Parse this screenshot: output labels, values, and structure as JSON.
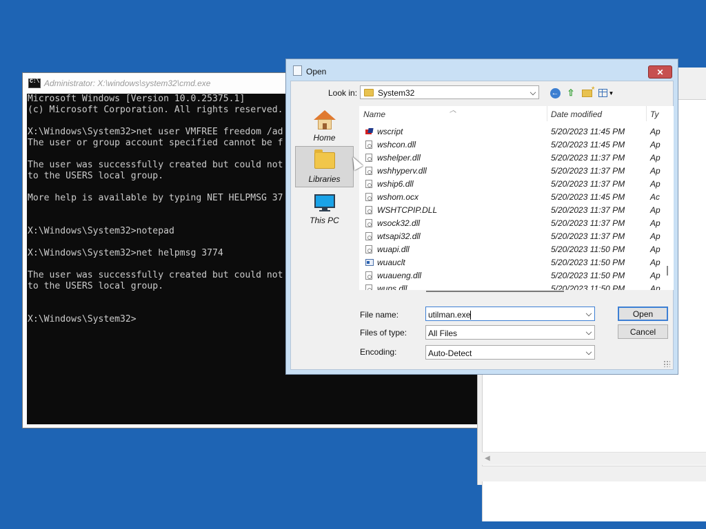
{
  "cmd_window": {
    "title": "Administrator: X:\\windows\\system32\\cmd.exe",
    "lines": [
      "Microsoft Windows [Version 10.0.25375.1]",
      "(c) Microsoft Corporation. All rights reserved.",
      "",
      "X:\\Windows\\System32>net user VMFREE freedom /ad",
      "The user or group account specified cannot be f",
      "",
      "The user was successfully created but could not",
      "to the USERS local group.",
      "",
      "More help is available by typing NET HELPMSG 37",
      "",
      "",
      "X:\\Windows\\System32>notepad",
      "",
      "X:\\Windows\\System32>net helpmsg 3774",
      "",
      "The user was successfully created but could not",
      "to the USERS local group.",
      "",
      "",
      "X:\\Windows\\System32>"
    ]
  },
  "open_dialog": {
    "title": "Open",
    "close_glyph": "✕",
    "look_in_label": "Look in:",
    "look_in_value": "System32",
    "toolbar_icons": [
      "back-icon",
      "up-folder-icon",
      "new-folder-icon",
      "view-menu-icon"
    ],
    "places": [
      {
        "label": "Home",
        "icon": "home-icon"
      },
      {
        "label": "Libraries",
        "icon": "libraries-folder-icon",
        "selected": true
      },
      {
        "label": "This PC",
        "icon": "this-pc-icon"
      }
    ],
    "columns": {
      "name": "Name",
      "date": "Date modified",
      "type": "Ty"
    },
    "files": [
      {
        "name": "wscript",
        "date": "5/20/2023 11:45 PM",
        "type": "Ap",
        "icon": "script"
      },
      {
        "name": "wshcon.dll",
        "date": "5/20/2023 11:45 PM",
        "type": "Ap",
        "icon": "dll"
      },
      {
        "name": "wshelper.dll",
        "date": "5/20/2023 11:37 PM",
        "type": "Ap",
        "icon": "dll"
      },
      {
        "name": "wshhyperv.dll",
        "date": "5/20/2023 11:37 PM",
        "type": "Ap",
        "icon": "dll"
      },
      {
        "name": "wship6.dll",
        "date": "5/20/2023 11:37 PM",
        "type": "Ap",
        "icon": "dll"
      },
      {
        "name": "wshom.ocx",
        "date": "5/20/2023 11:45 PM",
        "type": "Ac",
        "icon": "dll"
      },
      {
        "name": "WSHTCPIP.DLL",
        "date": "5/20/2023 11:37 PM",
        "type": "Ap",
        "icon": "dll"
      },
      {
        "name": "wsock32.dll",
        "date": "5/20/2023 11:37 PM",
        "type": "Ap",
        "icon": "dll"
      },
      {
        "name": "wtsapi32.dll",
        "date": "5/20/2023 11:37 PM",
        "type": "Ap",
        "icon": "dll"
      },
      {
        "name": "wuapi.dll",
        "date": "5/20/2023 11:50 PM",
        "type": "Ap",
        "icon": "dll"
      },
      {
        "name": "wuauclt",
        "date": "5/20/2023 11:50 PM",
        "type": "Ap",
        "icon": "exe"
      },
      {
        "name": "wuaueng.dll",
        "date": "5/20/2023 11:50 PM",
        "type": "Ap",
        "icon": "dll"
      },
      {
        "name": "wups.dll",
        "date": "5/20/2023 11:50 PM",
        "type": "Ap",
        "icon": "dll"
      }
    ],
    "file_name_label": "File name:",
    "file_name_value": "utilman.exe",
    "files_of_type_label": "Files of type:",
    "files_of_type_value": "All Files",
    "encoding_label": "Encoding:",
    "encoding_value": "Auto-Detect",
    "open_button": "Open",
    "cancel_button": "Cancel"
  },
  "notepad_window": {
    "scroll_left_glyph": "◀"
  },
  "colors": {
    "desktop": "#1e64b4",
    "console_bg": "#0c0c0c",
    "console_text": "#cccccc",
    "dialog_frame": "#c9e0f5",
    "close_button": "#c75050",
    "focus_blue": "#3c7fd4"
  }
}
